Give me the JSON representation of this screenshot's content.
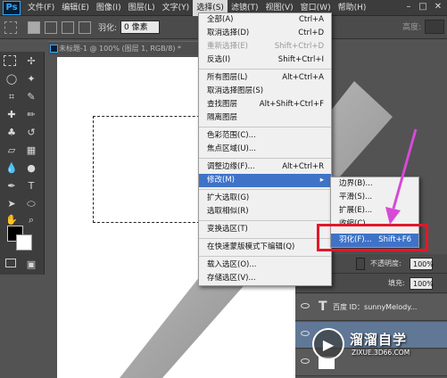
{
  "app": {
    "logo": "Ps"
  },
  "menubar": {
    "items": [
      "文件(F)",
      "编辑(E)",
      "图像(I)",
      "图层(L)",
      "文字(Y)",
      "选择(S)",
      "滤镜(T)",
      "视图(V)",
      "窗口(W)",
      "帮助(H)"
    ],
    "active_index": 5
  },
  "options_bar": {
    "feather_label": "羽化:",
    "feather_value": "0 像素",
    "height_label": "高度:"
  },
  "document": {
    "tab_title": "未标题-1 @ 100% (图层 1, RGB/8) *"
  },
  "select_menu": {
    "items": [
      {
        "label": "全部(A)",
        "shortcut": "Ctrl+A",
        "disabled": false
      },
      {
        "label": "取消选择(D)",
        "shortcut": "Ctrl+D",
        "disabled": false
      },
      {
        "label": "重新选择(E)",
        "shortcut": "Shift+Ctrl+D",
        "disabled": true
      },
      {
        "label": "反选(I)",
        "shortcut": "Shift+Ctrl+I",
        "disabled": false
      },
      {
        "sep": true
      },
      {
        "label": "所有图层(L)",
        "shortcut": "Alt+Ctrl+A",
        "disabled": false
      },
      {
        "label": "取消选择图层(S)",
        "shortcut": "",
        "disabled": false
      },
      {
        "label": "查找图层",
        "shortcut": "Alt+Shift+Ctrl+F",
        "disabled": false
      },
      {
        "label": "隔离图层",
        "shortcut": "",
        "disabled": false
      },
      {
        "sep": true
      },
      {
        "label": "色彩范围(C)...",
        "shortcut": "",
        "disabled": false
      },
      {
        "label": "焦点区域(U)...",
        "shortcut": "",
        "disabled": false
      },
      {
        "sep": true
      },
      {
        "label": "调整边缘(F)...",
        "shortcut": "Alt+Ctrl+R",
        "disabled": false
      },
      {
        "label": "修改(M)",
        "shortcut": "▸",
        "disabled": false,
        "highlight": true
      },
      {
        "sep": true
      },
      {
        "label": "扩大选取(G)",
        "shortcut": "",
        "disabled": false
      },
      {
        "label": "选取相似(R)",
        "shortcut": "",
        "disabled": false
      },
      {
        "sep": true
      },
      {
        "label": "变换选区(T)",
        "shortcut": "",
        "disabled": false
      },
      {
        "sep": true
      },
      {
        "label": "在快速蒙版模式下编辑(Q)",
        "shortcut": "",
        "disabled": false
      },
      {
        "sep": true
      },
      {
        "label": "载入选区(O)...",
        "shortcut": "",
        "disabled": false
      },
      {
        "label": "存储选区(V)...",
        "shortcut": "",
        "disabled": false
      }
    ]
  },
  "modify_submenu": {
    "items": [
      {
        "label": "边界(B)...",
        "shortcut": ""
      },
      {
        "label": "平滑(S)...",
        "shortcut": ""
      },
      {
        "label": "扩展(E)...",
        "shortcut": ""
      },
      {
        "label": "收缩(C)...",
        "shortcut": ""
      },
      {
        "label": "羽化(F)...",
        "shortcut": "Shift+F6",
        "highlight": true
      }
    ]
  },
  "layers_panel": {
    "opacity_label": "不透明度:",
    "opacity_value": "100%",
    "fill_label": "填充:",
    "fill_value": "100%",
    "text_layer_name": "百度 ID：sunnyMelody..."
  },
  "watermark": {
    "title": "溜溜自学",
    "subtitle": "ZIXUE.3D66.COM"
  },
  "colors": {
    "accent": "#3e73c8",
    "highlight_box": "#e0182a",
    "arrow": "#d64ad6"
  }
}
